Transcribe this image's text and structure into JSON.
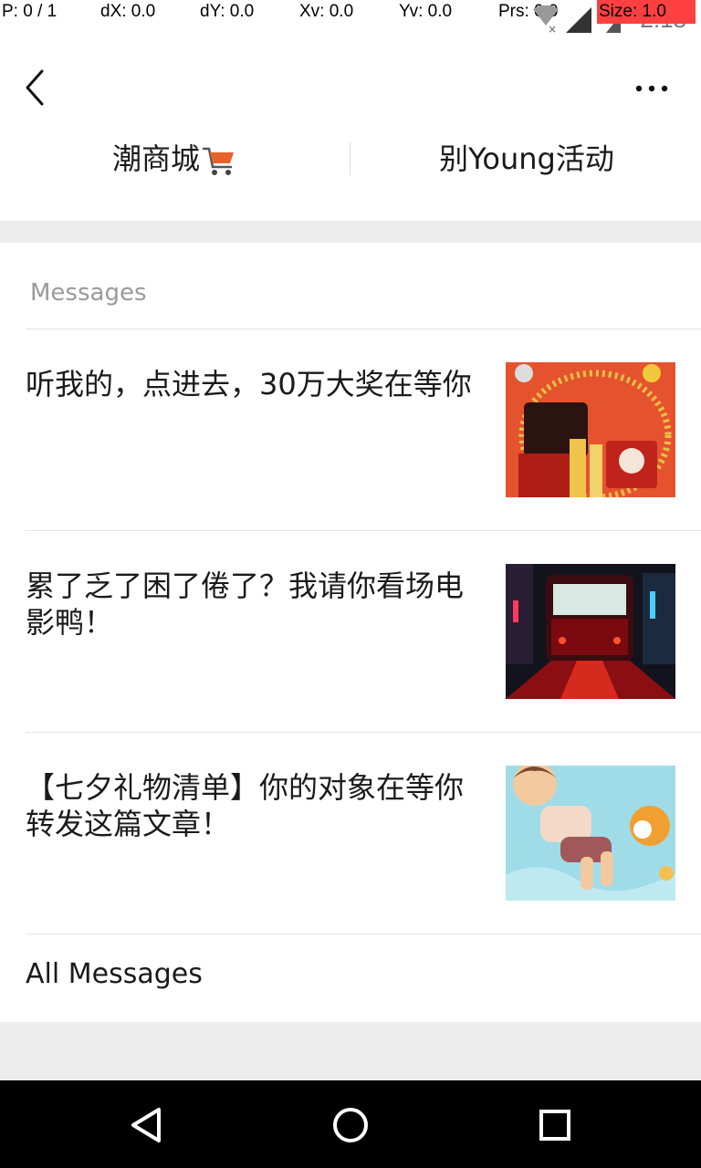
{
  "status_bar": {
    "debug": [
      "P: 0 / 1",
      "dX: 0.0",
      "dY: 0.0",
      "Xv: 0.0",
      "Yv: 0.0",
      "Prs: 0.0",
      "Size: 1.0"
    ],
    "time": "2:18"
  },
  "header": {
    "back_icon": "chevron-left-icon",
    "more_icon": "more-dots-icon"
  },
  "menu": {
    "left_label": "潮商城",
    "left_icon": "shopping-cart-icon",
    "right_label": "别Young活动"
  },
  "messages": {
    "section_title": "Messages",
    "items": [
      {
        "title": "听我的，点进去，30万大奖在等你",
        "thumb": "gold-prize-image"
      },
      {
        "title": "累了乏了困了倦了？我请你看场电影鸭！",
        "thumb": "night-tram-image"
      },
      {
        "title": "【七夕礼物清单】你的对象在等你转发这篇文章！",
        "thumb": "boy-floating-image"
      }
    ],
    "all_label": "All Messages"
  },
  "nav": {
    "back": "triangle-back-icon",
    "home": "circle-home-icon",
    "recents": "square-recents-icon"
  }
}
